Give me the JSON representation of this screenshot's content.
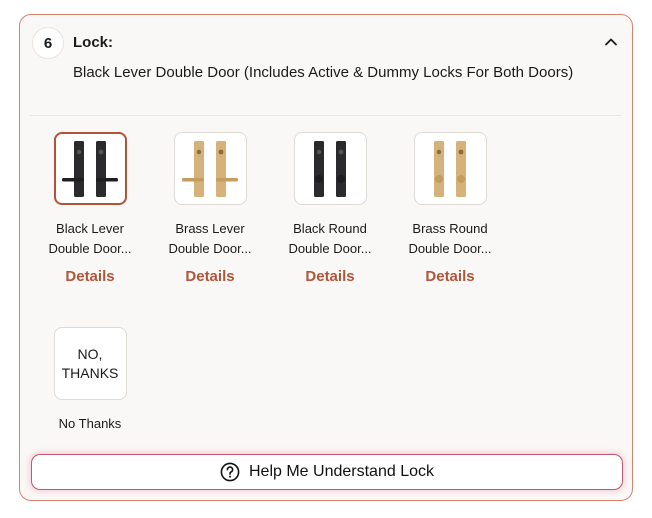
{
  "step": {
    "number": "6",
    "title": "Lock:",
    "selected_value": "Black Lever Double Door (Includes Active & Dummy Locks For Both Doors)"
  },
  "options": [
    {
      "label": "Black Lever\nDouble Door...",
      "details": "Details",
      "selected": true,
      "finish": "black",
      "style": "lever"
    },
    {
      "label": "Brass Lever\nDouble Door...",
      "details": "Details",
      "selected": false,
      "finish": "brass",
      "style": "lever"
    },
    {
      "label": "Black Round\nDouble Door...",
      "details": "Details",
      "selected": false,
      "finish": "black",
      "style": "round"
    },
    {
      "label": "Brass Round\nDouble Door...",
      "details": "Details",
      "selected": false,
      "finish": "brass",
      "style": "round"
    }
  ],
  "no_thanks": {
    "image_text": "NO,\nTHANKS",
    "label": "No Thanks"
  },
  "help_button": {
    "label": "Help Me Understand Lock"
  },
  "colors": {
    "accent": "#b2543a",
    "card_border": "#d6826f",
    "black_finish": "#2b2b2d",
    "brass_finish": "#d4b27a"
  }
}
